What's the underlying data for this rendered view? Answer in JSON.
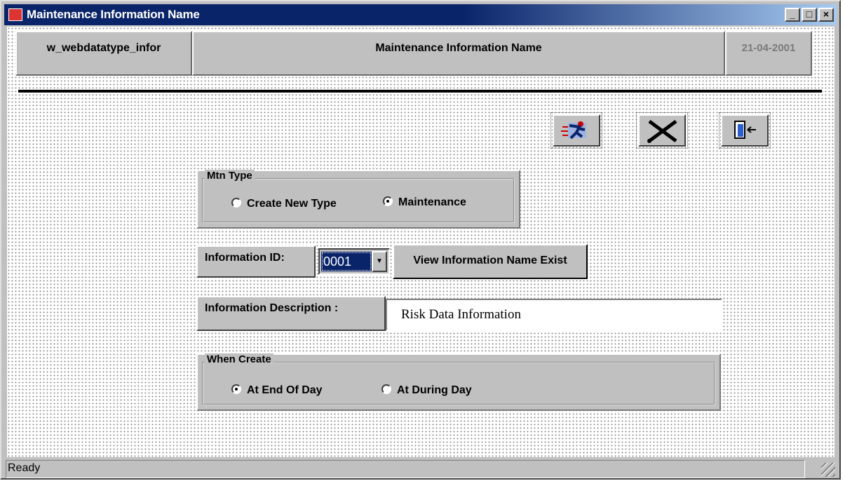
{
  "window": {
    "title": "Maintenance Information Name",
    "controls": [
      "_",
      "□",
      "×"
    ]
  },
  "header": {
    "window_name": "w_webdatatype_infor",
    "title": "Maintenance Information Name",
    "date": "21-04-2001"
  },
  "toolbar": {
    "buttons": [
      {
        "icon": "running-man-icon"
      },
      {
        "icon": "delete-x-icon"
      },
      {
        "icon": "exit-door-icon"
      }
    ]
  },
  "mtn_type": {
    "legend": "Mtn Type",
    "options": [
      "Create New Type",
      "Maintenance"
    ],
    "selected": "Maintenance"
  },
  "information_id": {
    "label": "Information ID:",
    "value": "0001",
    "view_button": "View Information Name Exist"
  },
  "information_description": {
    "label": "Information Description :",
    "value": "Risk Data Information"
  },
  "when_create": {
    "legend": "When Create",
    "options": [
      "At End Of Day",
      "At During Day"
    ],
    "selected": "At End Of Day"
  },
  "status": {
    "text": "Ready"
  }
}
